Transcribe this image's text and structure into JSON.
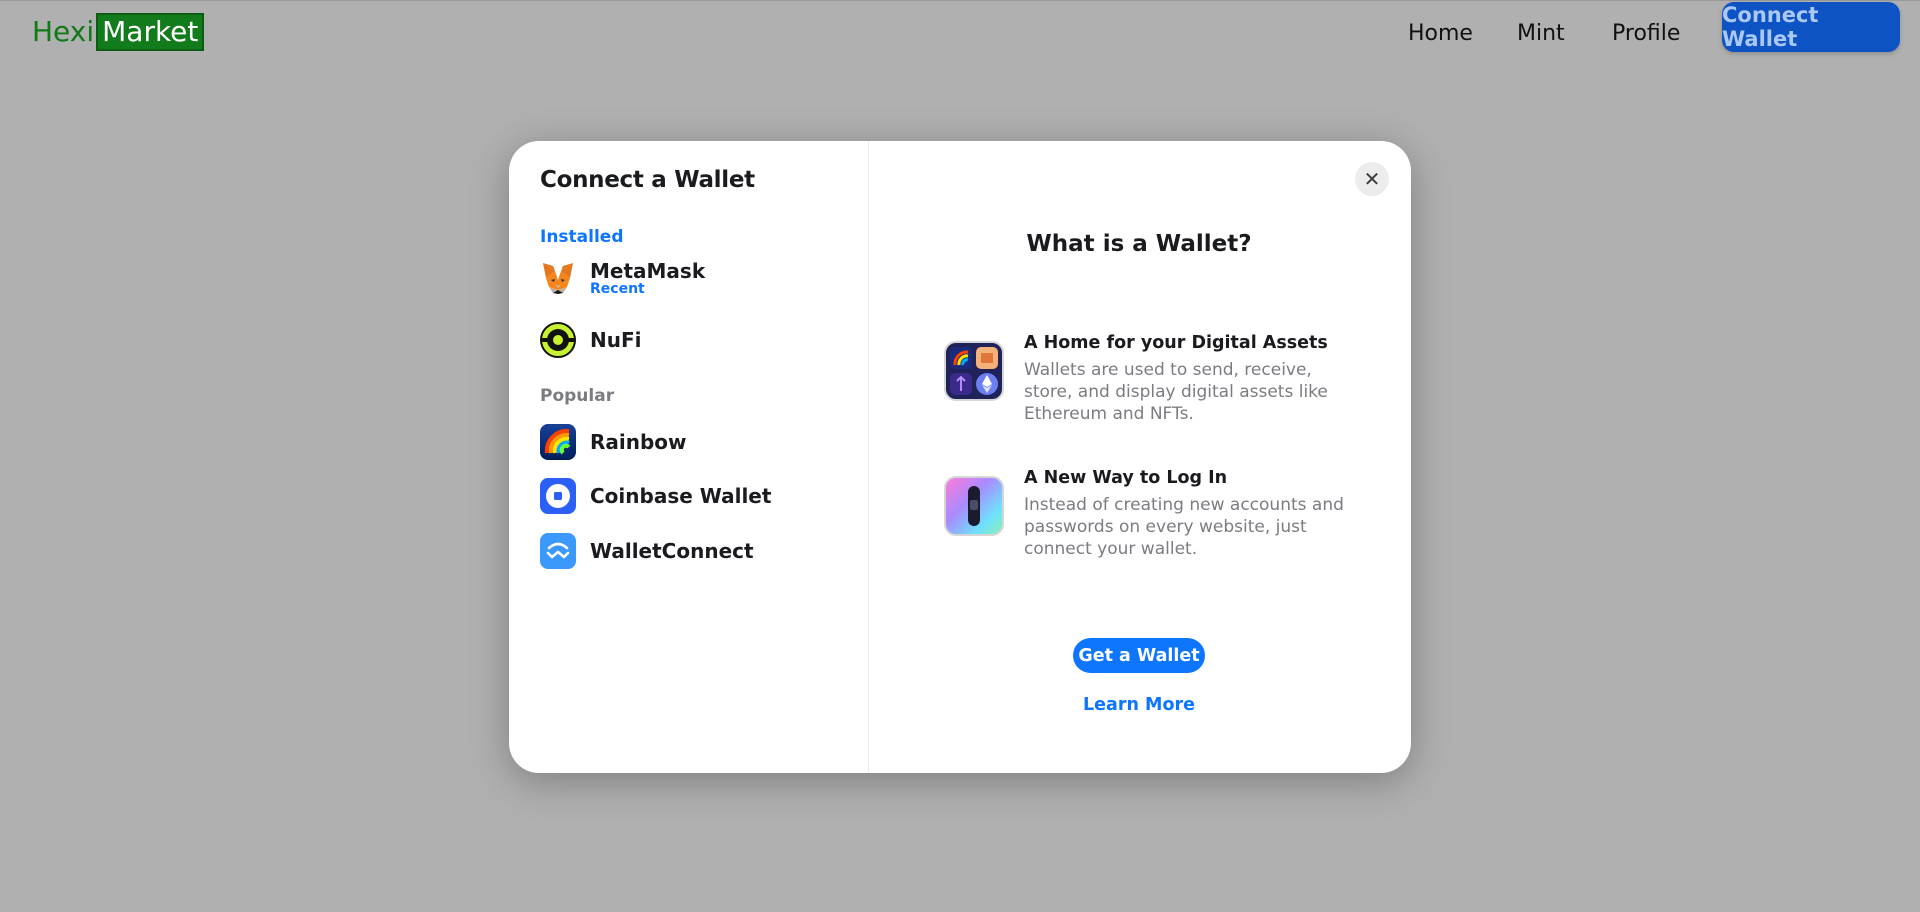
{
  "header": {
    "logo_part1": "Hexi",
    "logo_part2": "Market",
    "nav": [
      "Home",
      "Mint",
      "Profile"
    ],
    "connect_button": "Connect Wallet"
  },
  "modal": {
    "title": "Connect a Wallet",
    "installed_label": "Installed",
    "installed": [
      {
        "name": "MetaMask",
        "sub": "Recent",
        "icon": "metamask-icon"
      },
      {
        "name": "NuFi",
        "sub": "",
        "icon": "nufi-icon"
      }
    ],
    "popular_label": "Popular",
    "popular": [
      {
        "name": "Rainbow",
        "icon": "rainbow-icon"
      },
      {
        "name": "Coinbase Wallet",
        "icon": "coinbase-icon"
      },
      {
        "name": "WalletConnect",
        "icon": "walletconnect-icon"
      }
    ],
    "close_icon": "close-icon",
    "info": {
      "title": "What is a Wallet?",
      "features": [
        {
          "heading": "A Home for your Digital Assets",
          "body": "Wallets are used to send, receive, store, and display digital assets like Ethereum and NFTs.",
          "icon": "assets-icon"
        },
        {
          "heading": "A New Way to Log In",
          "body": "Instead of creating new accounts and passwords on every website, just connect your wallet.",
          "icon": "login-icon"
        }
      ],
      "get_wallet": "Get a Wallet",
      "learn_more": "Learn More"
    }
  },
  "colors": {
    "overlay": "#b0b0b0",
    "accent": "#0e76fd",
    "connect_button": "#0e53c4",
    "logo_green": "#127c1d"
  }
}
